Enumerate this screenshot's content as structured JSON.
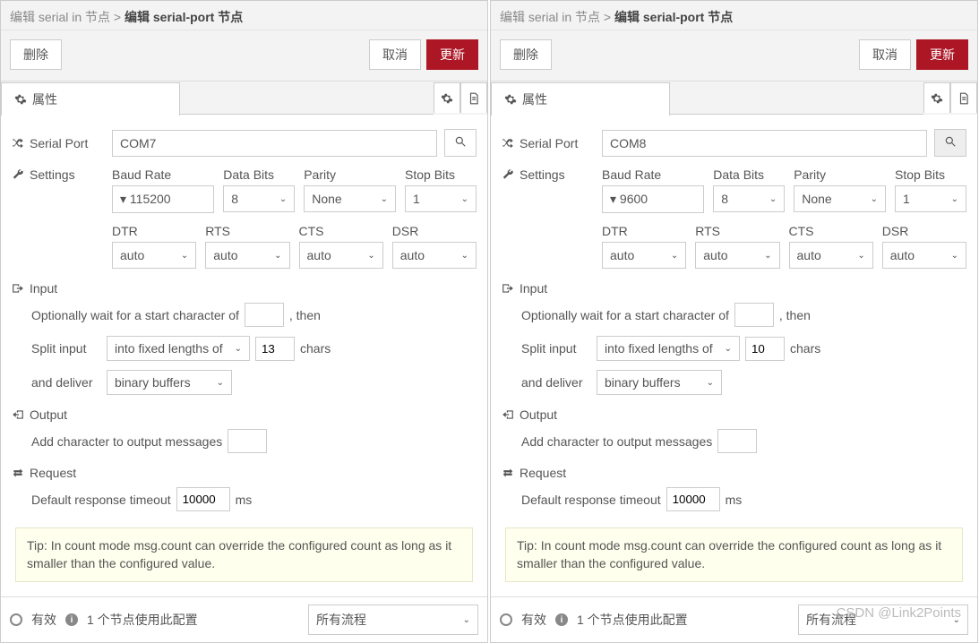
{
  "panes": [
    {
      "breadcrumb_prefix": "编辑 serial in 节点 > ",
      "breadcrumb_current": "编辑 serial-port 节点",
      "delete_label": "删除",
      "cancel_label": "取消",
      "update_label": "更新",
      "tab_label": "属性",
      "serial_port_label": "Serial Port",
      "serial_port_value": "COM7",
      "search_hl": false,
      "settings_label": "Settings",
      "baud_label": "Baud Rate",
      "baud_value": "115200",
      "databits_label": "Data Bits",
      "databits_value": "8",
      "parity_label": "Parity",
      "parity_value": "None",
      "stopbits_label": "Stop Bits",
      "stopbits_value": "1",
      "dtr_label": "DTR",
      "dtr_value": "auto",
      "rts_label": "RTS",
      "rts_value": "auto",
      "cts_label": "CTS",
      "cts_value": "auto",
      "dsr_label": "DSR",
      "dsr_value": "auto",
      "input_section": "Input",
      "wait_text_a": "Optionally wait for a start character of",
      "wait_text_b": ", then",
      "split_label": "Split input",
      "split_mode": "into fixed lengths of",
      "split_count": "13",
      "split_unit": "chars",
      "deliver_label": "and deliver",
      "deliver_mode": "binary buffers",
      "output_section": "Output",
      "output_text": "Add character to output messages",
      "request_section": "Request",
      "request_text": "Default response timeout",
      "request_value": "10000",
      "request_unit": "ms",
      "tip": "Tip: In count mode msg.count can override the configured count as long as it smaller than the configured value.",
      "footer_valid": "有效",
      "footer_usage": "1 个节点使用此配置",
      "footer_scope": "所有流程"
    },
    {
      "breadcrumb_prefix": "编辑 serial in 节点 > ",
      "breadcrumb_current": "编辑 serial-port 节点",
      "delete_label": "删除",
      "cancel_label": "取消",
      "update_label": "更新",
      "tab_label": "属性",
      "serial_port_label": "Serial Port",
      "serial_port_value": "COM8",
      "search_hl": true,
      "settings_label": "Settings",
      "baud_label": "Baud Rate",
      "baud_value": "9600",
      "databits_label": "Data Bits",
      "databits_value": "8",
      "parity_label": "Parity",
      "parity_value": "None",
      "stopbits_label": "Stop Bits",
      "stopbits_value": "1",
      "dtr_label": "DTR",
      "dtr_value": "auto",
      "rts_label": "RTS",
      "rts_value": "auto",
      "cts_label": "CTS",
      "cts_value": "auto",
      "dsr_label": "DSR",
      "dsr_value": "auto",
      "input_section": "Input",
      "wait_text_a": "Optionally wait for a start character of",
      "wait_text_b": ", then",
      "split_label": "Split input",
      "split_mode": "into fixed lengths of",
      "split_count": "10",
      "split_unit": "chars",
      "deliver_label": "and deliver",
      "deliver_mode": "binary buffers",
      "output_section": "Output",
      "output_text": "Add character to output messages",
      "request_section": "Request",
      "request_text": "Default response timeout",
      "request_value": "10000",
      "request_unit": "ms",
      "tip": "Tip: In count mode msg.count can override the configured count as long as it smaller than the configured value.",
      "footer_valid": "有效",
      "footer_usage": "1 个节点使用此配置",
      "footer_scope": "所有流程"
    }
  ],
  "watermark": "CSDN @Link2Points"
}
